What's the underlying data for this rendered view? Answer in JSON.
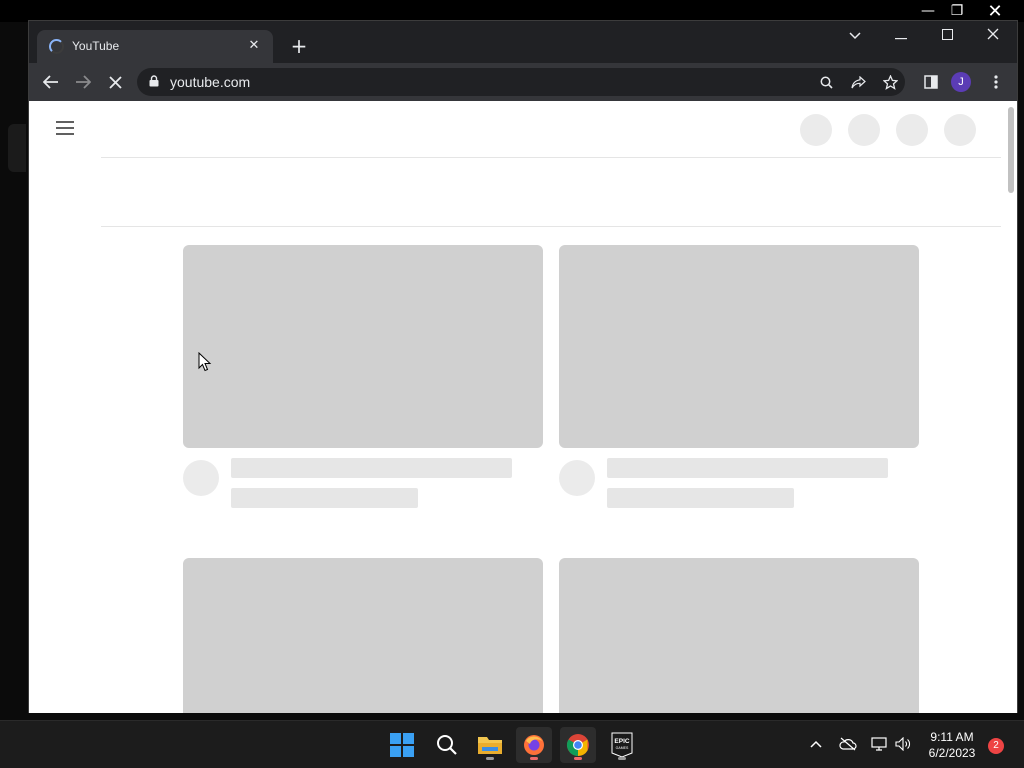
{
  "browser": {
    "tab": {
      "title": "YouTube",
      "close_glyph": "✕"
    },
    "new_tab_glyph": "+",
    "window_controls": {
      "minimize": "—",
      "maximize": "☐",
      "close": "✕",
      "tab_search": "⌄"
    },
    "toolbar": {
      "url": "youtube.com",
      "profile_initial": "J"
    }
  },
  "page": {
    "loading": true,
    "skeleton_cards": 4
  },
  "taskbar": {
    "apps": [
      "windows-start",
      "search",
      "file-explorer",
      "firefox",
      "chrome",
      "epic-games"
    ],
    "epic_label_top": "EPIC",
    "epic_label_bottom": "GAMES",
    "clock": {
      "time": "9:11 AM",
      "date": "6/2/2023"
    },
    "notification_count": "2"
  },
  "colors": {
    "skeleton_thumb": "#d0d0d0",
    "skeleton_line": "#e6e6e6",
    "chrome_dark": "#35363a",
    "avatar": "#5b3cb5",
    "spinner": "#8ab4f8"
  }
}
